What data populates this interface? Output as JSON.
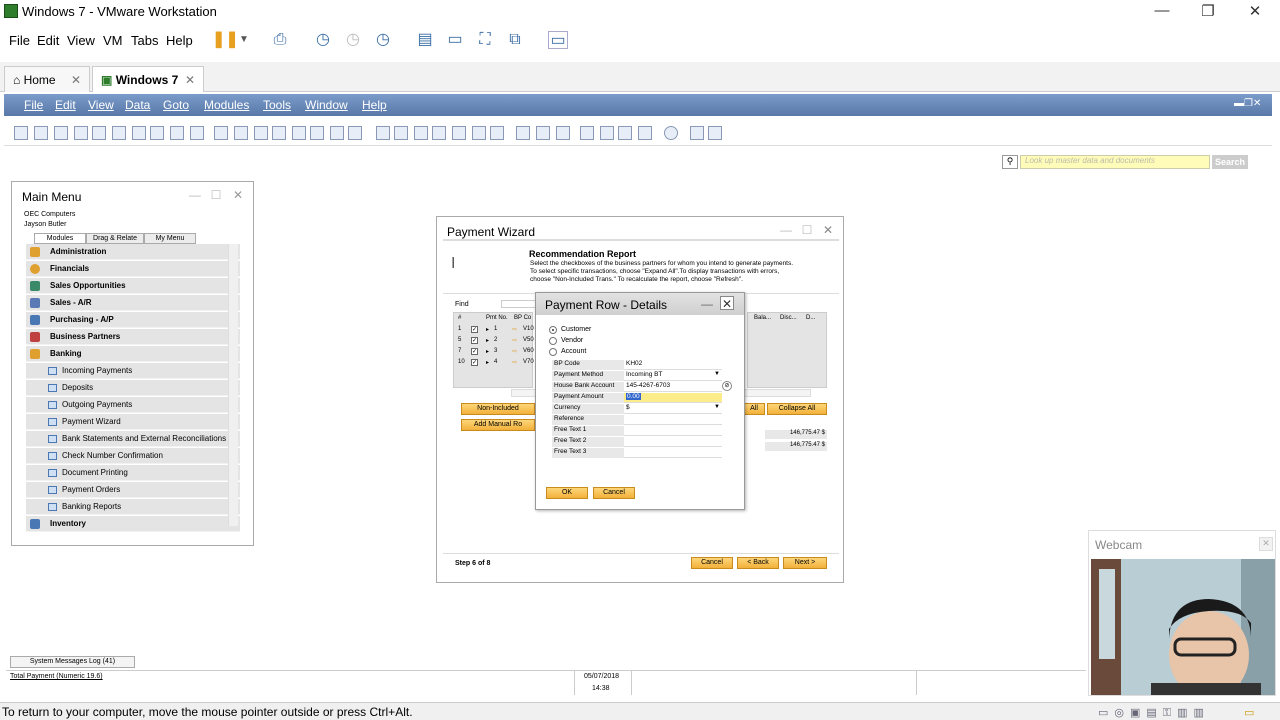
{
  "window": {
    "title": "Windows 7 - VMware Workstation",
    "minimize": "—",
    "restore": "❐",
    "close": "✕"
  },
  "vm_menu": {
    "items": [
      "File",
      "Edit",
      "View",
      "VM",
      "Tabs",
      "Help"
    ]
  },
  "tabs": [
    {
      "label": "Home",
      "close": "✕"
    },
    {
      "label": "Windows 7",
      "close": "✕"
    }
  ],
  "sap_menu": {
    "items": [
      "File",
      "Edit",
      "View",
      "Data",
      "Goto",
      "Modules",
      "Tools",
      "Window",
      "Help"
    ]
  },
  "search": {
    "placeholder": "Look up master data and documents",
    "button": "Search"
  },
  "main_menu": {
    "title": "Main Menu",
    "company": "OEC Computers",
    "user": "Jayson Butler",
    "tabs": [
      "Modules",
      "Drag & Relate",
      "My Menu"
    ],
    "modules": [
      "Administration",
      "Financials",
      "Sales Opportunities",
      "Sales - A/R",
      "Purchasing - A/P",
      "Business Partners",
      "Banking"
    ],
    "banking_items": [
      "Incoming Payments",
      "Deposits",
      "Outgoing Payments",
      "Payment Wizard",
      "Bank Statements and External Reconciliations",
      "Check Number Confirmation",
      "Document Printing",
      "Payment Orders",
      "Banking Reports"
    ],
    "last_module": "Inventory"
  },
  "wizard": {
    "title": "Payment Wizard",
    "report_title": "Recommendation Report",
    "instructions": [
      "Select the checkboxes of the business partners for whom you intend to generate payments.",
      "To select specific transactions, choose \"Expand All\".To display transactions with errors,",
      "choose \"Non-Included Trans.\" To recalculate the report, choose \"Refresh\"."
    ],
    "find_label": "Find",
    "grid_headers": [
      "#",
      "Pmt No.",
      "BP Co",
      "Bala...",
      "Disc...",
      "D..."
    ],
    "rows": [
      {
        "num": "1",
        "pmt": "1",
        "bp": "V10"
      },
      {
        "num": "5",
        "pmt": "2",
        "bp": "V50"
      },
      {
        "num": "7",
        "pmt": "3",
        "bp": "V60"
      },
      {
        "num": "10",
        "pmt": "4",
        "bp": "V70"
      }
    ],
    "non_included_btn": "Non-Included",
    "add_manual_btn": "Add Manual Ro",
    "expand_all_tail": "All",
    "collapse_btn": "Collapse All",
    "total1": "146,775.47 $",
    "total2": "146,775.47 $",
    "step": "Step 6 of 8",
    "cancel": "Cancel",
    "back": "< Back",
    "next": "Next >"
  },
  "details": {
    "title": "Payment Row - Details",
    "close": "✕",
    "radios": [
      "Customer",
      "Vendor",
      "Account"
    ],
    "fields": [
      {
        "label": "BP Code",
        "value": "KH02"
      },
      {
        "label": "Payment Method",
        "value": "Incoming BT"
      },
      {
        "label": "House Bank Account",
        "value": "145-4267-6703"
      },
      {
        "label": "Payment Amount",
        "value": "0.00"
      },
      {
        "label": "Currency",
        "value": "$"
      },
      {
        "label": "Reference",
        "value": ""
      },
      {
        "label": "Free Text 1",
        "value": ""
      },
      {
        "label": "Free Text 2",
        "value": ""
      },
      {
        "label": "Free Text 3",
        "value": ""
      }
    ],
    "ok": "OK",
    "cancel": "Cancel"
  },
  "bottom": {
    "message_log": "System Messages Log (41)",
    "field_info": "Total Payment (Numeric 19.6)",
    "date": "05/07/2018",
    "time": "14:38"
  },
  "webcam": {
    "title": "Webcam"
  },
  "vm_status": "To return to your computer, move the mouse pointer outside or press Ctrl+Alt."
}
